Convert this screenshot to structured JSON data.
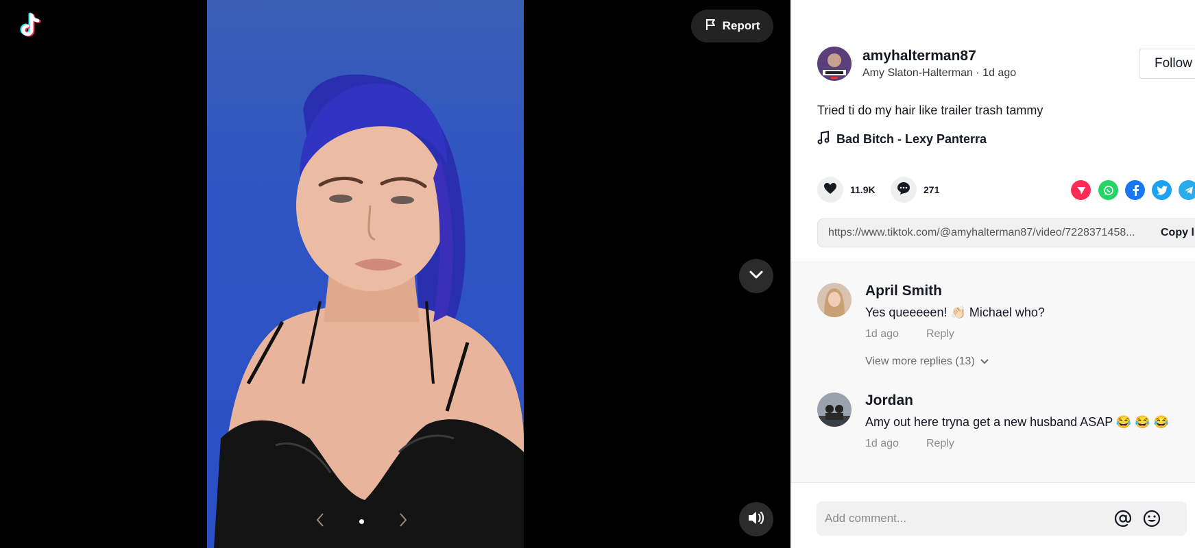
{
  "header": {
    "report_label": "Report"
  },
  "video": {
    "carousel_total": 1,
    "carousel_active": 1
  },
  "author": {
    "username": "amyhalterman87",
    "display_name": "Amy Slaton-Halterman",
    "separator": " · ",
    "posted": "1d ago",
    "follow_label": "Follow"
  },
  "post": {
    "caption": "Tried ti do my hair like trailer trash tammy",
    "music": "Bad Bitch - Lexy Panterra",
    "likes": "11.9K",
    "comments": "271",
    "link": "https://www.tiktok.com/@amyhalterman87/video/7228371458...",
    "copy_label": "Copy link"
  },
  "share_icons": [
    "direct-message-icon",
    "whatsapp-icon",
    "facebook-icon",
    "twitter-icon",
    "telegram-icon"
  ],
  "comments": [
    {
      "name": "April Smith",
      "text": "Yes queeeeen! 👏🏻 Michael who?",
      "time": "1d ago",
      "reply_label": "Reply",
      "more_replies": "View more replies (13)"
    },
    {
      "name": "Jordan",
      "text": "Amy out here tryna get a new husband ASAP 😂 😂 😂",
      "time": "1d ago",
      "reply_label": "Reply"
    }
  ],
  "add_comment": {
    "placeholder": "Add comment..."
  },
  "colors": {
    "accent": "#fe2c55",
    "whatsapp": "#25d366",
    "facebook": "#1877f2",
    "twitter": "#1da1f2",
    "telegram": "#2aabee"
  }
}
